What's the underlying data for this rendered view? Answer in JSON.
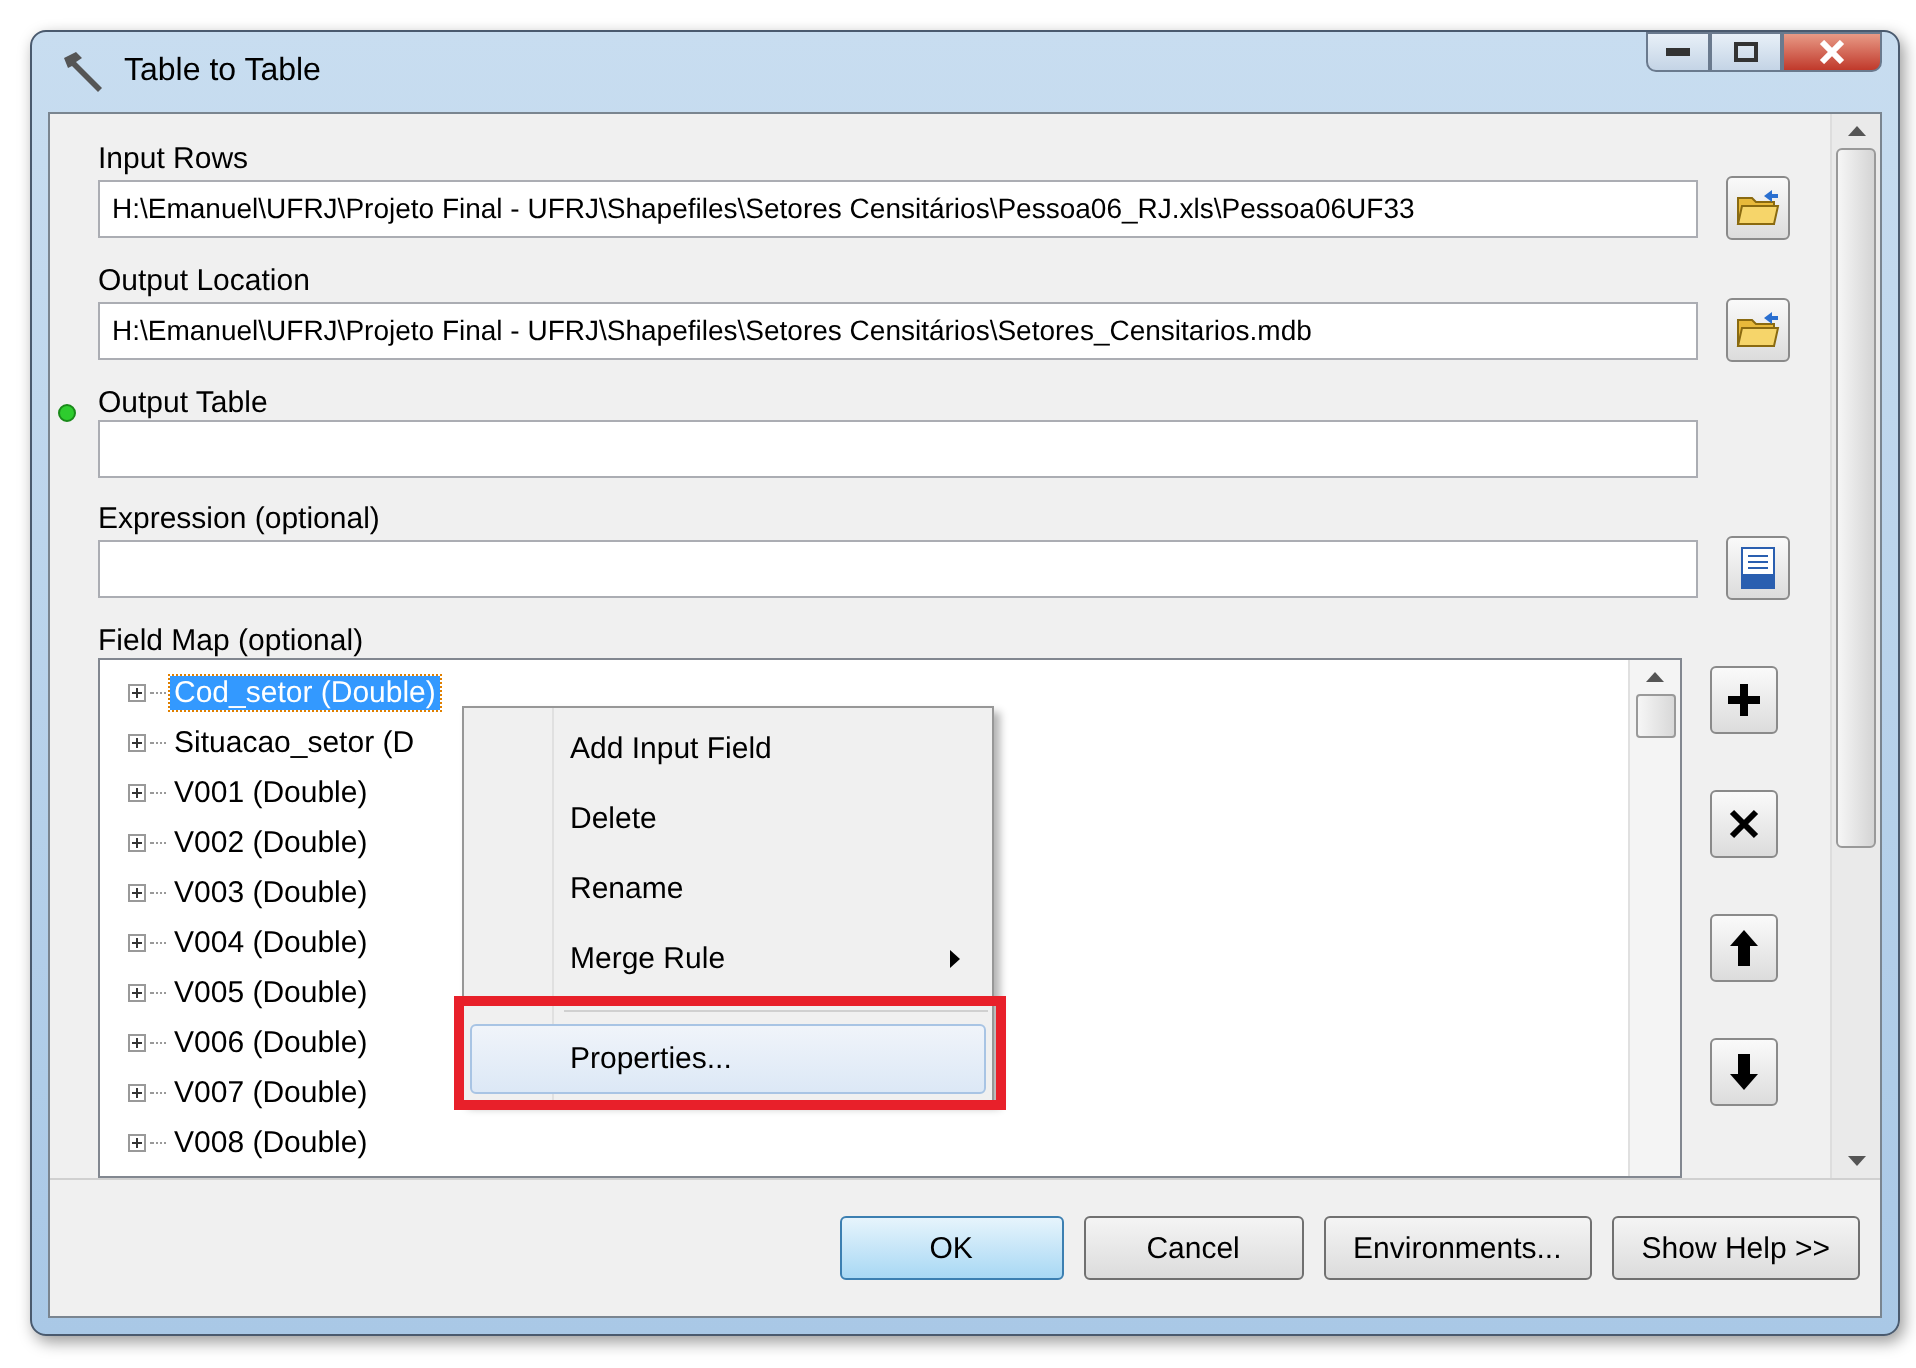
{
  "window": {
    "title": "Table to Table"
  },
  "params": [
    {
      "label": "Input Rows",
      "value": "H:\\Emanuel\\UFRJ\\Projeto Final - UFRJ\\Shapefiles\\Setores Censitários\\Pessoa06_RJ.xls\\Pessoa06UF33",
      "kind": "folder",
      "required": false
    },
    {
      "label": "Output Location",
      "value": "H:\\Emanuel\\UFRJ\\Projeto Final - UFRJ\\Shapefiles\\Setores Censitários\\Setores_Censitarios.mdb",
      "kind": "folder",
      "required": false
    },
    {
      "label": "Output Table",
      "kind": "plain",
      "required": true
    },
    {
      "label": "Expression (optional)",
      "kind": "sql",
      "required": false
    }
  ],
  "field_map": {
    "label": "Field Map (optional)",
    "items": [
      {
        "label": "Cod_setor (Double)",
        "selected": true
      },
      {
        "label": "Situacao_setor (D",
        "selected": false
      },
      {
        "label": "V001 (Double)",
        "selected": false
      },
      {
        "label": "V002 (Double)",
        "selected": false
      },
      {
        "label": "V003 (Double)",
        "selected": false
      },
      {
        "label": "V004 (Double)",
        "selected": false
      },
      {
        "label": "V005 (Double)",
        "selected": false
      },
      {
        "label": "V006 (Double)",
        "selected": false
      },
      {
        "label": "V007 (Double)",
        "selected": false
      },
      {
        "label": "V008 (Double)",
        "selected": false
      }
    ],
    "actions": [
      {
        "kind": "add"
      },
      {
        "kind": "delete"
      },
      {
        "kind": "up"
      },
      {
        "kind": "down"
      }
    ]
  },
  "context_menu": {
    "items": [
      {
        "label": "Add Input Field",
        "submenu": false,
        "highlighted": false
      },
      {
        "label": "Delete",
        "submenu": false,
        "highlighted": false
      },
      {
        "label": "Rename",
        "submenu": false,
        "highlighted": false
      },
      {
        "label": "Merge Rule",
        "submenu": true,
        "highlighted": false
      },
      {
        "label": "Properties...",
        "submenu": false,
        "highlighted": true
      }
    ]
  },
  "buttons": [
    {
      "label": "OK",
      "default": true
    },
    {
      "label": "Cancel",
      "default": false
    },
    {
      "label": "Environments...",
      "default": false
    },
    {
      "label": "Show Help >>",
      "default": false
    }
  ]
}
